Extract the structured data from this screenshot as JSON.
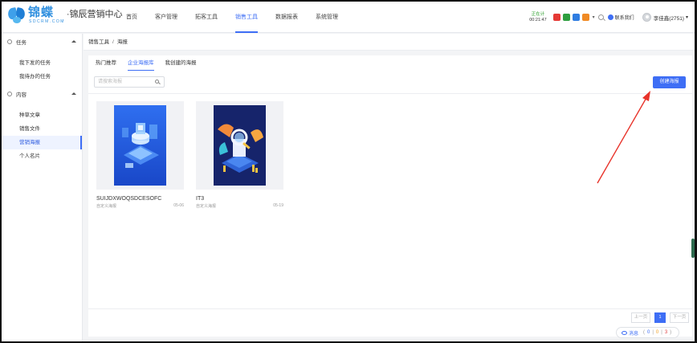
{
  "header": {
    "logo_cn": "锦蝶",
    "logo_en": "SDCRM.COM",
    "logo_sub": "·锦辰营销中心",
    "nav": [
      {
        "label": "首页"
      },
      {
        "label": "客户管理"
      },
      {
        "label": "拓客工具"
      },
      {
        "label": "销售工具",
        "active": true
      },
      {
        "label": "数据报表"
      },
      {
        "label": "系统管理"
      }
    ],
    "timer_status": "正在计",
    "timer_value": "00:21:47",
    "app_icons": [
      {
        "name": "red-app-icon",
        "color": "#e53935"
      },
      {
        "name": "green-app-icon",
        "color": "#2e9e3f"
      },
      {
        "name": "blue-app-icon",
        "color": "#2f7de1"
      },
      {
        "name": "orange-app-icon",
        "color": "#f08a24"
      }
    ],
    "contact_label": "联系我们",
    "user_label": "李佳鑫(2751)"
  },
  "sidebar": {
    "groups": [
      {
        "label": "任务",
        "items": [
          {
            "label": "我下发的任务"
          },
          {
            "label": "我待办的任务"
          }
        ]
      },
      {
        "label": "内容",
        "items": [
          {
            "label": "种草文章"
          },
          {
            "label": "销售文件"
          },
          {
            "label": "营销海报",
            "active": true
          },
          {
            "label": "个人名片"
          }
        ]
      }
    ]
  },
  "breadcrumb": {
    "parent": "销售工具",
    "separator": "/",
    "current": "海报"
  },
  "main": {
    "tabs": [
      {
        "label": "热门推荐"
      },
      {
        "label": "企业海报库",
        "active": true
      },
      {
        "label": "我创建的海报"
      }
    ],
    "search_placeholder": "请搜索海报",
    "create_button": "创建海报",
    "posters": [
      {
        "name": "SUIJDXWOQSDCESOFC",
        "type": "自定义海报",
        "date": "05-06"
      },
      {
        "name": "IT3",
        "type": "自定义海报",
        "date": "05-19"
      }
    ],
    "pagination": {
      "prev": "上一页",
      "page": "1",
      "next": "下一页"
    }
  },
  "message_bar": {
    "label": "消息",
    "counts": [
      "0",
      "0",
      "3"
    ],
    "separator": "|"
  },
  "colors": {
    "primary": "#3e6ef5",
    "annotation_arrow": "#e8332a"
  }
}
